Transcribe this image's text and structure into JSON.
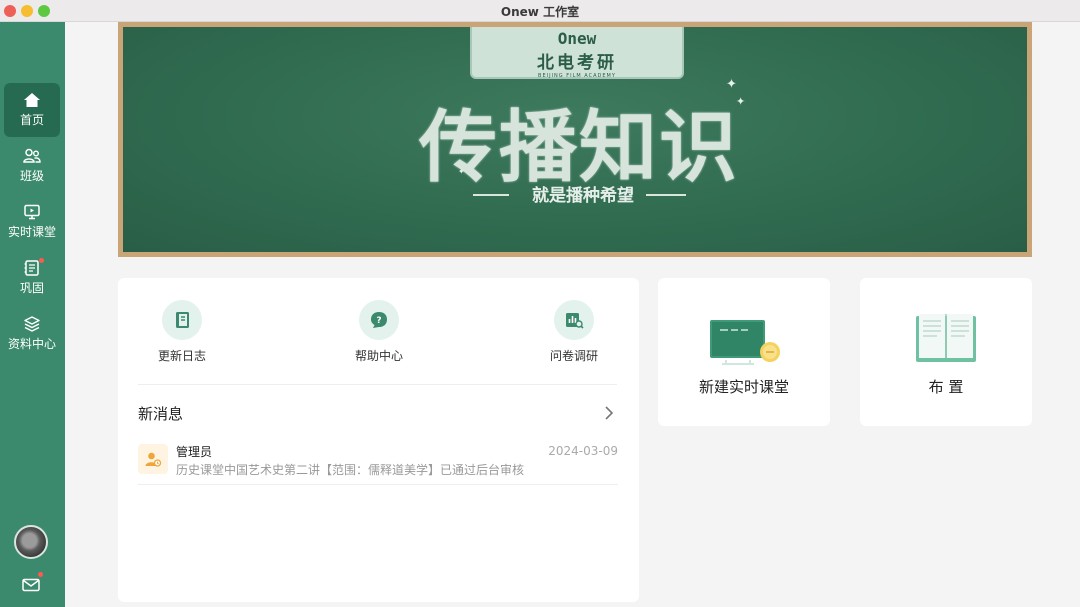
{
  "window": {
    "title": "Onew 工作室"
  },
  "sidebar": {
    "items": [
      {
        "label": "首页",
        "icon": "home-icon",
        "active": true
      },
      {
        "label": "班级",
        "icon": "users-icon"
      },
      {
        "label": "实时课堂",
        "icon": "live-class-icon"
      },
      {
        "label": "巩固",
        "icon": "notebook-icon",
        "badge": true
      },
      {
        "label": "资料中心",
        "icon": "layers-icon"
      }
    ],
    "mail_badge": true
  },
  "banner": {
    "sign_en": "Onew",
    "sign_cn": "北电考研",
    "sign_small": "BEIJING FILM ACADEMY",
    "title": "传播知识",
    "subtitle": "就是播种希望"
  },
  "quick_links": [
    {
      "label": "更新日志",
      "icon": "book-icon"
    },
    {
      "label": "帮助中心",
      "icon": "help-icon"
    },
    {
      "label": "问卷调研",
      "icon": "survey-chart-icon"
    }
  ],
  "news": {
    "title": "新消息",
    "messages": [
      {
        "sender": "管理员",
        "date": "2024-03-09",
        "text": "历史课堂中国艺术史第二讲【范围：儒释道美学】已通过后台审核"
      }
    ]
  },
  "cards": [
    {
      "label": "新建实时课堂",
      "icon": "blackboard-icon"
    },
    {
      "label": "布  置",
      "icon": "open-book-icon"
    }
  ],
  "colors": {
    "sidebar": "#3b8a6d",
    "sidebar_active": "#276a52",
    "accent": "#3b8a6d",
    "chalkboard": "#2f6a4f",
    "frame": "#c8a476"
  }
}
